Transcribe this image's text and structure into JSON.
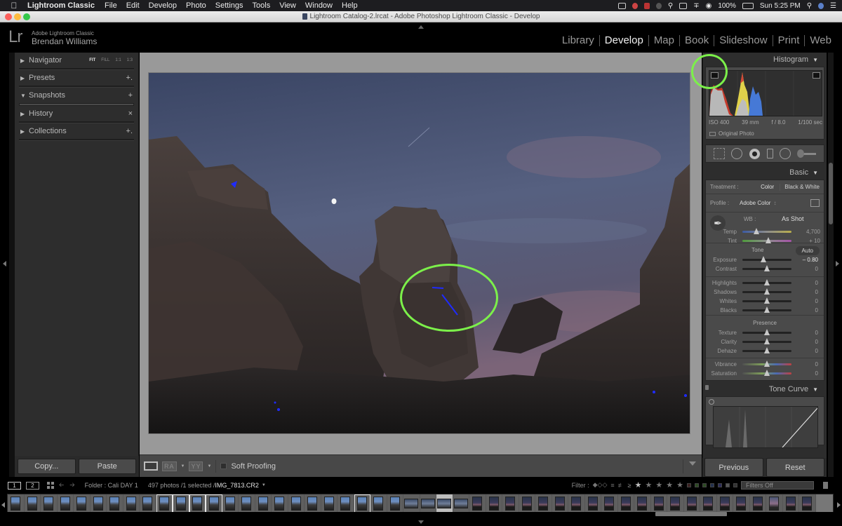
{
  "menubar": {
    "app_name": "Lightroom Classic",
    "items": [
      "File",
      "Edit",
      "Develop",
      "Photo",
      "Settings",
      "Tools",
      "View",
      "Window",
      "Help"
    ],
    "battery": "100%",
    "clock": "Sun 5:25 PM"
  },
  "window": {
    "title": "Lightroom Catalog-2.lrcat - Adobe Photoshop Lightroom Classic - Develop"
  },
  "identity": {
    "logo": "Lr",
    "product": "Adobe Lightroom Classic",
    "user": "Brendan Williams"
  },
  "modules": {
    "items": [
      "Library",
      "Develop",
      "Map",
      "Book",
      "Slideshow",
      "Print",
      "Web"
    ],
    "active": "Develop"
  },
  "left_panel": {
    "sections": [
      {
        "label": "Navigator",
        "expanded": false,
        "options": [
          "FIT",
          "FILL",
          "1:1",
          "1:3"
        ]
      },
      {
        "label": "Presets",
        "expanded": false,
        "action": "+."
      },
      {
        "label": "Snapshots",
        "expanded": true,
        "action": "+"
      },
      {
        "label": "History",
        "expanded": false,
        "action": "×"
      },
      {
        "label": "Collections",
        "expanded": false,
        "action": "+."
      }
    ],
    "copy_label": "Copy...",
    "paste_label": "Paste"
  },
  "toolbar": {
    "before_after_1": "RA",
    "before_after_2": "YY",
    "soft_proofing_label": "Soft Proofing",
    "soft_proofing_checked": false
  },
  "right_panel": {
    "histogram": {
      "title": "Histogram",
      "iso": "ISO 400",
      "focal": "39 mm",
      "aperture": "f / 8.0",
      "shutter": "1/100 sec",
      "original_photo_label": "Original Photo"
    },
    "basic": {
      "title": "Basic",
      "treatment_label": "Treatment :",
      "treatment_color": "Color",
      "treatment_bw": "Black & White",
      "profile_label": "Profile :",
      "profile_value": "Adobe Color",
      "wb_label": "WB :",
      "wb_value": "As Shot",
      "tone_label": "Tone",
      "auto_label": "Auto",
      "presence_label": "Presence",
      "sliders": {
        "temp": {
          "label": "Temp",
          "value": "4,700",
          "position": 0.28
        },
        "tint": {
          "label": "Tint",
          "value": "+ 10",
          "position": 0.53
        },
        "exposure": {
          "label": "Exposure",
          "value": "– 0.80",
          "position": 0.43
        },
        "contrast": {
          "label": "Contrast",
          "value": "0",
          "position": 0.5
        },
        "highlights": {
          "label": "Highlights",
          "value": "0",
          "position": 0.5
        },
        "shadows": {
          "label": "Shadows",
          "value": "0",
          "position": 0.5
        },
        "whites": {
          "label": "Whites",
          "value": "0",
          "position": 0.5
        },
        "blacks": {
          "label": "Blacks",
          "value": "0",
          "position": 0.5
        },
        "texture": {
          "label": "Texture",
          "value": "0",
          "position": 0.5
        },
        "clarity": {
          "label": "Clarity",
          "value": "0",
          "position": 0.5
        },
        "dehaze": {
          "label": "Dehaze",
          "value": "0",
          "position": 0.5
        },
        "vibrance": {
          "label": "Vibrance",
          "value": "0",
          "position": 0.5
        },
        "saturation": {
          "label": "Saturation",
          "value": "0",
          "position": 0.5
        }
      }
    },
    "tone_curve": {
      "title": "Tone Curve"
    },
    "previous_label": "Previous",
    "reset_label": "Reset"
  },
  "filmstrip_header": {
    "screen1": "1",
    "screen2": "2",
    "folder": "Folder : Cali DAY 1",
    "count": "497 photos /1 selected /",
    "filename": "IMG_7813.CR2",
    "filter_label": "Filter :",
    "rating_op": "≥",
    "filters_value": "Filters Off"
  },
  "filmstrip": {
    "thumbs": [
      "day",
      "day",
      "day",
      "day",
      "day",
      "day",
      "day",
      "day",
      "day",
      "day-hi",
      "day-hi",
      "day-hi",
      "day-hi",
      "day",
      "day",
      "day",
      "day",
      "day",
      "day",
      "day",
      "day",
      "day-hi",
      "day",
      "day",
      "land",
      "land",
      "land-sel",
      "land",
      "sunset",
      "sunset",
      "sunset",
      "sunset",
      "sunset",
      "sunset",
      "sunset",
      "sunset",
      "sunset",
      "sunset",
      "sunset",
      "sunset",
      "sunset",
      "sunset",
      "sunset",
      "sunset",
      "sunset",
      "sunset",
      "sunset2",
      "sunset",
      "sunset"
    ]
  },
  "colors": {
    "accent_annotation": "#7cf04a",
    "clipping_blue": "#1f2bff",
    "panel_bg": "#2d2d2d",
    "loupe_bg": "#999999"
  }
}
